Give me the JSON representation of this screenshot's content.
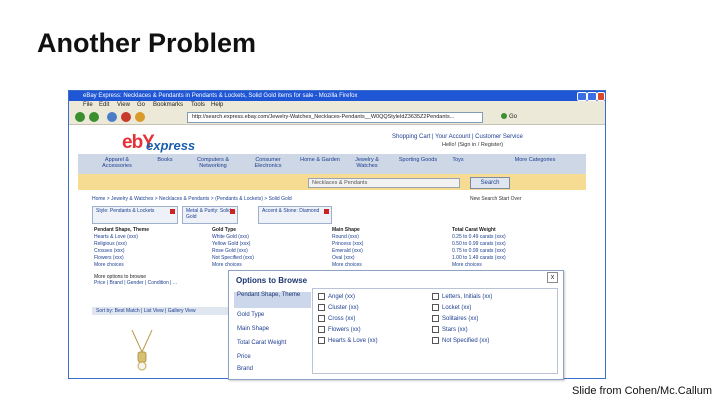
{
  "slide": {
    "title": "Another Problem",
    "credit": "Slide from Cohen/Mc.Callum"
  },
  "browser": {
    "title": "eBay Express: Necklaces & Pendants in Pendants & Lockets, Solid Gold items for sale - Mozilla Firefox",
    "menu": [
      "File",
      "Edit",
      "View",
      "Go",
      "Bookmarks",
      "Tools",
      "Help"
    ],
    "url": "http://search.express.ebay.com/Jewelry-Watches_Necklaces-Pendants__W0QQStyleIdZ3635Z2Pendants...",
    "go_label": "Go"
  },
  "page": {
    "logo_mark": "ebY",
    "logo_text": "express",
    "top_links": "Shopping Cart | Your Account | Customer Service",
    "hello": "Hello! (Sign in / Register)",
    "categories": [
      {
        "label": "Apparel & Accessories"
      },
      {
        "label": "Books"
      },
      {
        "label": "Computers & Networking"
      },
      {
        "label": "Consumer Electronics"
      },
      {
        "label": "Home & Garden"
      },
      {
        "label": "Jewelry & Watches"
      },
      {
        "label": "Sporting Goods"
      },
      {
        "label": "Toys"
      },
      {
        "label": "More Categories"
      }
    ],
    "search_value": "Necklaces & Pendants",
    "search_button": "Search",
    "breadcrumb": "Home > Jewelry & Watches > Necklaces & Pendants > (Pendants & Lockets) > Solid Gold",
    "new_search": "New Search  Start Over",
    "tags": [
      {
        "label": "Style: Pendants & Lockets"
      },
      {
        "label": "Metal & Purity: Solid Gold"
      },
      {
        "label": "Accent & Stone: Diamond"
      }
    ],
    "columns": [
      {
        "heading": "Pendant Shape, Theme",
        "items": [
          "Hearts & Love (xxx)",
          "Religious (xxx)",
          "Crosses (xxx)",
          "Flowers (xxx)",
          "More choices"
        ]
      },
      {
        "heading": "Gold Type",
        "items": [
          "White Gold (xxx)",
          "Yellow Gold (xxx)",
          "Rose Gold (xxx)",
          "Not Specified (xxx)",
          "More choices"
        ]
      },
      {
        "heading": "Main Shape",
        "items": [
          "Round (xxx)",
          "Princess (xxx)",
          "Emerald (xxx)",
          "Oval (xxx)",
          "More choices"
        ]
      },
      {
        "heading": "Total Carat Weight",
        "items": [
          "0.25 to 0.49 carats (xxx)",
          "0.50 to 0.99 carats (xxx)",
          "0.75 to 0.99 carats (xxx)",
          "1.00 to 1.49 carats (xxx)",
          "More choices"
        ]
      }
    ],
    "more_options_heading": "More options to browse",
    "more_options": "Price | Brand | Gender | Condition | ...",
    "results_bar": "Sort by: Best Match  |  List View  |  Gallery View"
  },
  "overlay": {
    "title": "Options to Browse",
    "close": "x",
    "side_items": [
      "Pendant Shape, Theme",
      "Gold Type",
      "Main Shape",
      "Total Carat Weight",
      "Price",
      "Brand"
    ],
    "selected_index": 0,
    "options_left": [
      "Angel (xx)",
      "Cluster (xx)",
      "Cross (xx)",
      "Flowers (xx)",
      "Hearts & Love (xx)"
    ],
    "options_right": [
      "Letters, Initials (xx)",
      "Locket (xx)",
      "Solitaires (xx)",
      "Stars (xx)",
      "Not Specified (xx)"
    ]
  },
  "colors": {
    "ebay_red": "#e53238",
    "ebay_blue": "#1b5fae",
    "search_band": "#f6dc92",
    "titlebar": "#1f56d6"
  }
}
